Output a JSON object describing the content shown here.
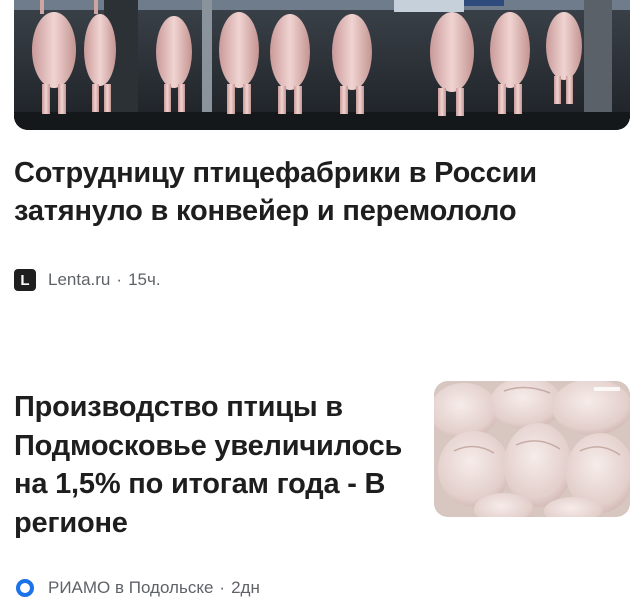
{
  "articles": [
    {
      "headline": "Сотрудницу птицефабрики в России затянуло в конвейер и перемололо",
      "source_logo_letter": "L",
      "source": "Lenta.ru",
      "separator": "·",
      "time": "15ч.",
      "image_icon": "poultry-conveyor-photo"
    },
    {
      "headline": "Производство птицы в Подмосковье увеличилось на 1,5% по итогам года - В регионе",
      "source_logo_icon": "riamo-ring-icon",
      "source": "РИАМО в Подольске",
      "separator": "·",
      "time": "2дн",
      "image_icon": "chicken-carcasses-photo"
    }
  ],
  "colors": {
    "headline_text": "#1e1e1e",
    "meta_text": "#5f6368",
    "riamo_brand": "#1a73e8",
    "lenta_logo_bg": "#1f1f1f"
  }
}
